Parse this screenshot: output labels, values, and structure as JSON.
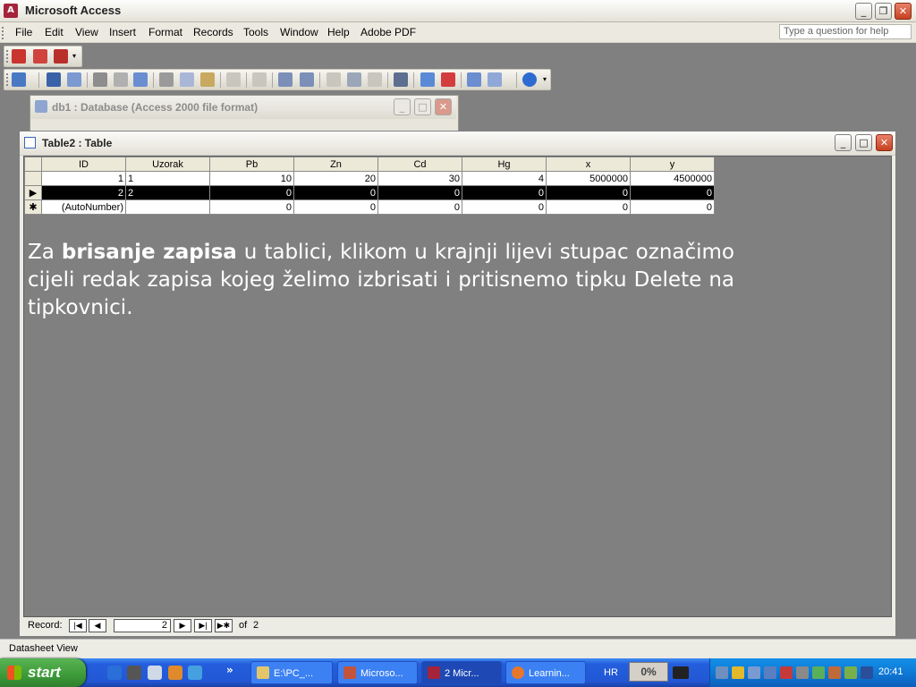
{
  "app": {
    "title": "Microsoft Access",
    "question_placeholder": "Type a question for help"
  },
  "menu": [
    "File",
    "Edit",
    "View",
    "Insert",
    "Format",
    "Records",
    "Tools",
    "Window",
    "Help",
    "Adobe PDF"
  ],
  "db_window": {
    "title": "db1 : Database (Access 2000 file format)"
  },
  "table_window": {
    "title": "Table2 : Table"
  },
  "grid": {
    "columns": [
      "ID",
      "Uzorak",
      "Pb",
      "Zn",
      "Cd",
      "Hg",
      "x",
      "y"
    ],
    "rows": [
      {
        "marker": "",
        "cells": [
          "1",
          "1",
          "10",
          "20",
          "30",
          "4",
          "5000000",
          "4500000"
        ]
      },
      {
        "marker": "▶",
        "cells": [
          "2",
          "2",
          "0",
          "0",
          "0",
          "0",
          "0",
          "0"
        ]
      },
      {
        "marker": "✱",
        "cells": [
          "(AutoNumber)",
          "",
          "0",
          "0",
          "0",
          "0",
          "0",
          "0"
        ]
      }
    ]
  },
  "caption": {
    "before": "Za ",
    "bold": "brisanje zapisa",
    "after": " u tablici, klikom u krajnji lijevi stupac označimo cijeli redak zapisa kojeg želimo izbrisati i pritisnemo tipku Delete na tipkovnici."
  },
  "record_nav": {
    "label": "Record:",
    "current": "2",
    "of_label": "of",
    "total": "2"
  },
  "status": {
    "text": "Datasheet View"
  },
  "taskbar": {
    "start_label": "start",
    "tasks": [
      {
        "label": "E:\\PC_...",
        "color": "#e3c66a"
      },
      {
        "label": "Microso...",
        "color": "#c2543b"
      },
      {
        "label": "2 Micr...",
        "color": "#a4243b"
      },
      {
        "label": "Learnin...",
        "color": "#e7772b"
      }
    ],
    "lang": "HR",
    "cpu": "0%",
    "clock": "20:41"
  }
}
